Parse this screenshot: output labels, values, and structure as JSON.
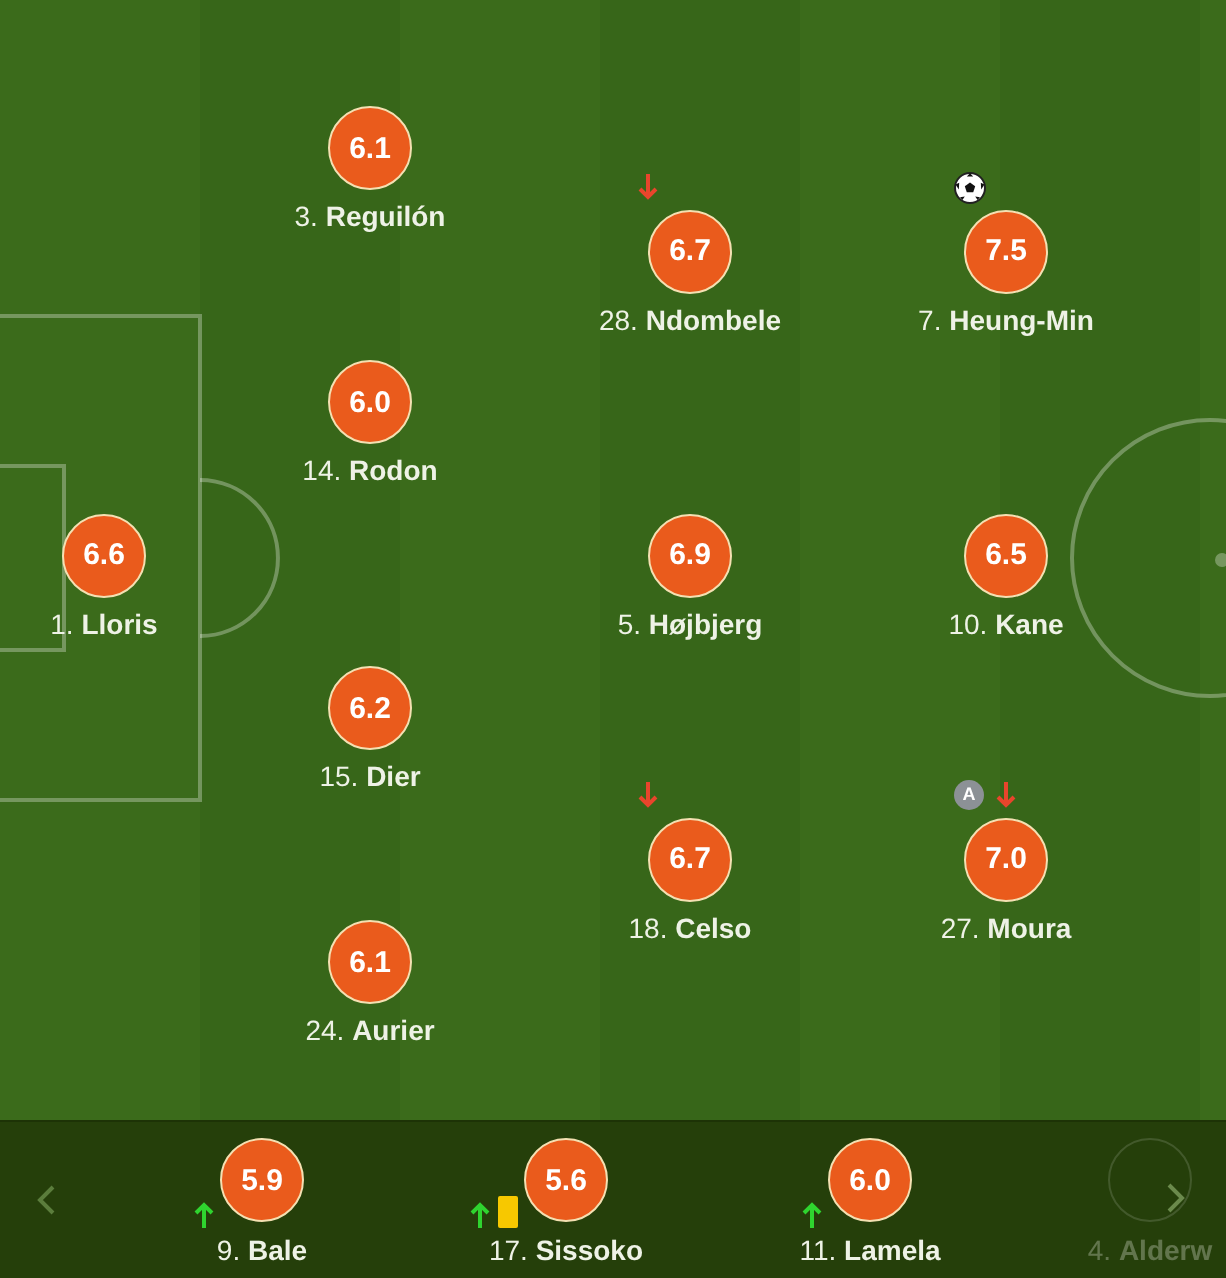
{
  "pitch": {
    "lines": [
      {
        "players": [
          {
            "number": "1.",
            "name": "Lloris",
            "rating": "6.6"
          }
        ]
      },
      {
        "players": [
          {
            "number": "3.",
            "name": "Reguilón",
            "rating": "6.1"
          },
          {
            "number": "14.",
            "name": "Rodon",
            "rating": "6.0"
          },
          {
            "number": "15.",
            "name": "Dier",
            "rating": "6.2"
          },
          {
            "number": "24.",
            "name": "Aurier",
            "rating": "6.1"
          }
        ]
      },
      {
        "players": [
          {
            "number": "28.",
            "name": "Ndombele",
            "rating": "6.7",
            "events": [
              {
                "kind": "sub_out"
              }
            ]
          },
          {
            "number": "5.",
            "name": "Højbjerg",
            "rating": "6.9"
          },
          {
            "number": "18.",
            "name": "Celso",
            "rating": "6.7",
            "events": [
              {
                "kind": "sub_out"
              }
            ]
          }
        ]
      },
      {
        "players": [
          {
            "number": "7.",
            "name": "Heung-Min",
            "rating": "7.5",
            "events": [
              {
                "kind": "goal"
              }
            ]
          },
          {
            "number": "10.",
            "name": "Kane",
            "rating": "6.5"
          },
          {
            "number": "27.",
            "name": "Moura",
            "rating": "7.0",
            "captain_badge": "A",
            "events": [
              {
                "kind": "sub_out"
              }
            ]
          }
        ]
      }
    ]
  },
  "bench": {
    "players": [
      {
        "number": "9.",
        "name": "Bale",
        "rating": "5.9",
        "dimmed": false,
        "events": [
          {
            "kind": "sub_in"
          }
        ]
      },
      {
        "number": "17.",
        "name": "Sissoko",
        "rating": "5.6",
        "dimmed": false,
        "events": [
          {
            "kind": "sub_in"
          },
          {
            "kind": "yellow_card"
          }
        ]
      },
      {
        "number": "11.",
        "name": "Lamela",
        "rating": "6.0",
        "dimmed": false,
        "events": [
          {
            "kind": "sub_in"
          }
        ]
      },
      {
        "number": "4.",
        "name": "Alderw",
        "dimmed": true
      }
    ]
  }
}
